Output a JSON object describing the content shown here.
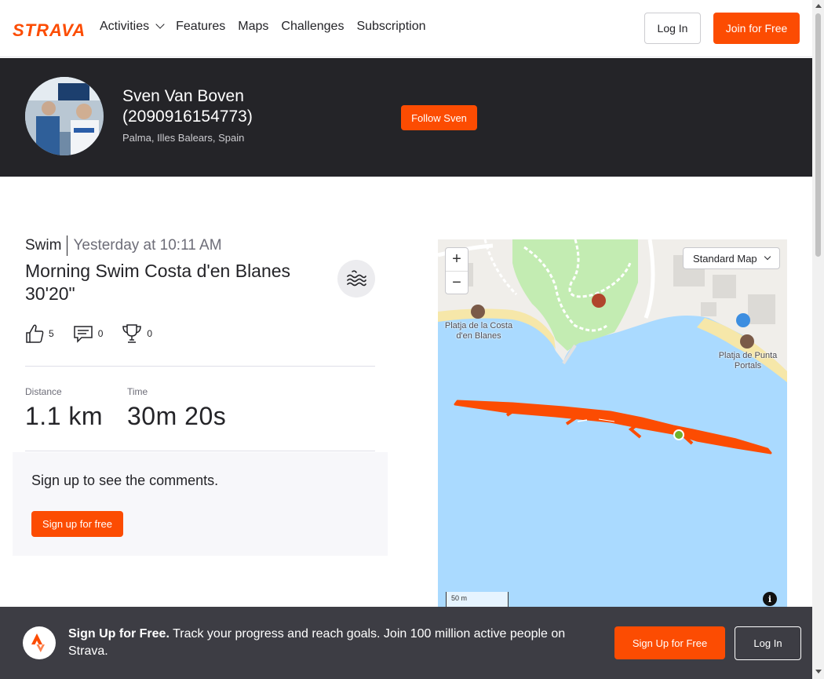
{
  "nav": {
    "logo": "STRAVA",
    "links": [
      "Activities",
      "Features",
      "Maps",
      "Challenges",
      "Subscription"
    ],
    "login_label": "Log In",
    "join_label": "Join for Free"
  },
  "athlete": {
    "name": "Sven Van Boven (2090916154773)",
    "location": "Palma, Illes Balears, Spain",
    "follow_label": "Follow Sven"
  },
  "activity": {
    "type": "Swim",
    "date": "Yesterday at 10:11 AM",
    "title": "Morning Swim Costa d'en Blanes 30'20\"",
    "sport_icon": "swim-waves-icon",
    "kudos_count": "5",
    "comment_count": "0",
    "achievement_count": "0",
    "stats": [
      {
        "label": "Distance",
        "value": "1.1 km"
      },
      {
        "label": "Time",
        "value": "30m 20s"
      }
    ]
  },
  "comments": {
    "title": "Sign up to see the comments.",
    "signup_label": "Sign up for free"
  },
  "map": {
    "zoom_in": "+",
    "zoom_out": "−",
    "style_select": "Standard Map",
    "scale_label": "50 m",
    "info": "i",
    "poi_1": "Platja de la Costa d'en Blanes",
    "poi_2": "Platja de Punta Portals",
    "route_color": "#fc4c02",
    "water_color": "#aadaff"
  },
  "banner": {
    "title": "Sign Up for Free.",
    "text": "Track your progress and reach goals. Join 100 million active people on Strava.",
    "signup_label": "Sign Up for Free",
    "login_label": "Log In"
  }
}
